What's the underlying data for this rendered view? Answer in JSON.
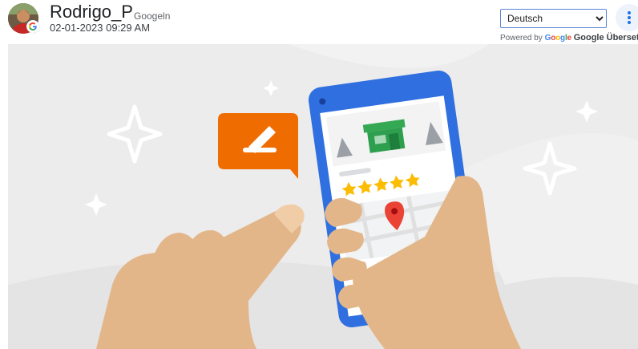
{
  "review": {
    "username": "Rodrigo_P",
    "source": "Googeln",
    "date": "02-01-2023 09:29 AM"
  },
  "translate": {
    "selected_language": "Deutsch",
    "powered_by": "Powered by",
    "google_word": "Google",
    "service_name": "Google Übersetzer"
  },
  "icons": {
    "more": "more-vert-icon",
    "dropdown": "chevron-down-icon",
    "edit": "pencil-icon",
    "map_pin": "map-pin-icon",
    "star": "star-icon"
  },
  "colors": {
    "accent": "#1a73e8",
    "phone_body": "#2f6fe0",
    "edit_bubble": "#ef6c00",
    "star": "#fbbc04",
    "pin": "#ea4335",
    "store": "#34a853",
    "skin": "#e3b68a"
  }
}
